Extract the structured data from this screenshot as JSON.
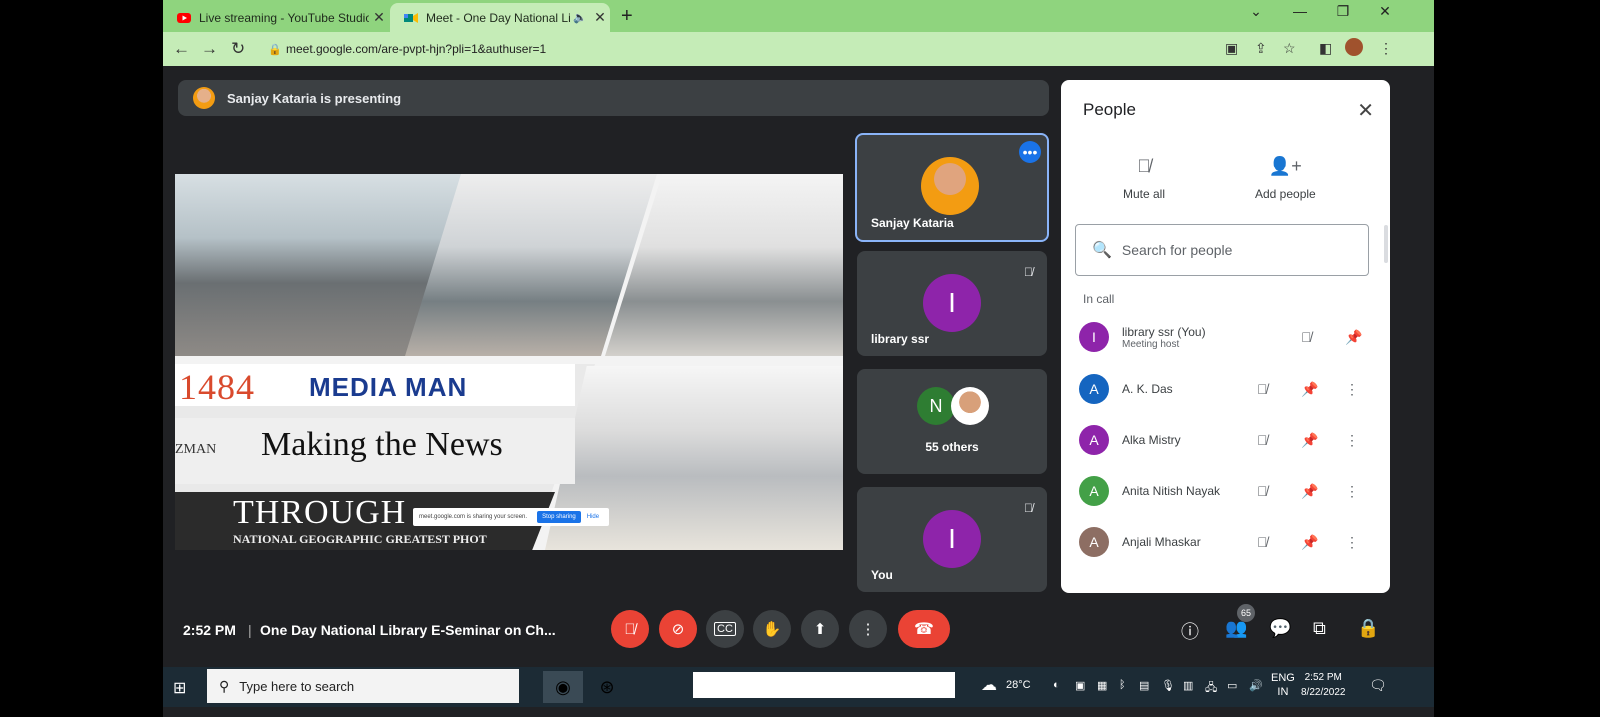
{
  "browser": {
    "tabs": [
      {
        "title": "Live streaming - YouTube Studio",
        "favicon": "youtube-icon",
        "color": "#ff0000"
      },
      {
        "title": "Meet - One Day National Lib",
        "favicon": "meet-icon",
        "color": "#00897b"
      }
    ],
    "url": "meet.google.com/are-pvpt-hjn?pli=1&authuser=1"
  },
  "banner": {
    "text": "Sanjay Kataria is presenting"
  },
  "slide": {
    "t1484": "1484",
    "media_man": "MEDIA MAN",
    "zman": "ZMAN",
    "making": "Making the News",
    "through": "THROUGH",
    "natgeo": "NATIONAL GEOGRAPHIC GREATEST PHOT",
    "share_text": "meet.google.com is sharing your screen.",
    "stop_sharing": "Stop sharing",
    "hide": "Hide"
  },
  "tiles": [
    {
      "name": "Sanjay Kataria"
    },
    {
      "name": "library ssr",
      "initial": "I",
      "color": "#8e24aa"
    },
    {
      "name": "55 others",
      "initial": "N",
      "color": "#2e7d32"
    },
    {
      "name": "You",
      "initial": "I",
      "color": "#8e24aa"
    }
  ],
  "people": {
    "title": "People",
    "mute_all": "Mute all",
    "add_people": "Add people",
    "search_placeholder": "Search for people",
    "section": "In call",
    "rows": [
      {
        "name": "library ssr (You)",
        "sub": "Meeting host",
        "initial": "I",
        "color": "#8e24aa"
      },
      {
        "name": "A. K. Das",
        "initial": "A",
        "color": "#1565c0"
      },
      {
        "name": "Alka Mistry",
        "initial": "A",
        "color": "#8e24aa"
      },
      {
        "name": "Anita Nitish Nayak",
        "initial": "A",
        "color": "#43a047"
      },
      {
        "name": "Anjali Mhaskar",
        "initial": "A",
        "color": "#8d6e63"
      }
    ]
  },
  "controls": {
    "time": "2:52 PM",
    "meeting_name": "One Day National Library E-Seminar on Ch...",
    "people_count": "65"
  },
  "taskbar": {
    "search_placeholder": "Type here to search",
    "temperature": "28°C",
    "lang1": "ENG",
    "lang2": "IN",
    "time": "2:52 PM",
    "date": "8/22/2022"
  }
}
